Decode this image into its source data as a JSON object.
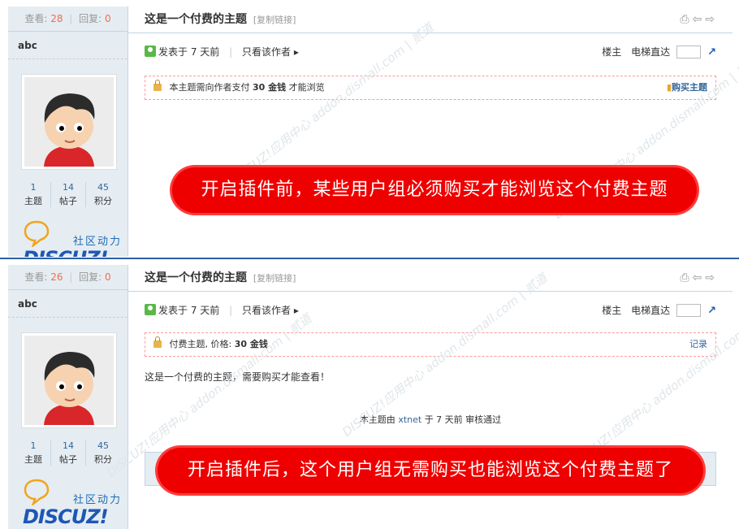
{
  "panels": [
    {
      "stats": {
        "views_label": "查看:",
        "views": "28",
        "sep": "|",
        "replies_label": "回复:",
        "replies": "0"
      },
      "username": "abc",
      "counts": [
        {
          "num": "1",
          "label": "主题"
        },
        {
          "num": "14",
          "label": "帖子"
        },
        {
          "num": "45",
          "label": "积分"
        }
      ],
      "logo": {
        "slogan": "社区动力",
        "brand": "DISCUZ!"
      },
      "title": "这是一个付费的主题",
      "copy_link": "[复制链接]",
      "posted": "发表于 7 天前",
      "author_only": "只看该作者",
      "floor": "楼主",
      "elevator": "电梯直达",
      "pay_prefix": "本主题需向作者支付",
      "pay_amount": "30 金钱",
      "pay_suffix": "才能浏览",
      "buy_label": "购买主题",
      "banner": "开启插件前，某些用户组必须购买才能浏览这个付费主题"
    },
    {
      "stats": {
        "views_label": "查看:",
        "views": "26",
        "sep": "|",
        "replies_label": "回复:",
        "replies": "0"
      },
      "username": "abc",
      "counts": [
        {
          "num": "1",
          "label": "主题"
        },
        {
          "num": "14",
          "label": "帖子"
        },
        {
          "num": "45",
          "label": "积分"
        }
      ],
      "logo": {
        "slogan": "社区动力",
        "brand": "DISCUZ!"
      },
      "title": "这是一个付费的主题",
      "copy_link": "[复制链接]",
      "posted": "发表于 7 天前",
      "author_only": "只看该作者",
      "floor": "楼主",
      "elevator": "电梯直达",
      "pay_prefix": "付费主题, 价格:",
      "pay_amount": "30 金钱",
      "record_label": "记录",
      "post_text": "这是一个付费的主题，需要购买才能查看！",
      "audit_prefix": "本主题由",
      "audit_user": "xtnet",
      "audit_suffix": "于 7 天前 审核通过",
      "banner": "开启插件后，这个用户组无需购买也能浏览这个付费主题了"
    }
  ],
  "watermark": "DISCUZ!应用中心 addon.dismall.com | 贰道",
  "icons": [
    "print-icon",
    "prev-icon",
    "next-icon",
    "user-icon",
    "lock-icon",
    "buy-icon",
    "go-icon",
    "bubble-icon"
  ],
  "colors": {
    "accent": "#336699",
    "banner": "#ef0000",
    "sidebar": "#e5edf2",
    "stat_num": "#f26c4f"
  }
}
